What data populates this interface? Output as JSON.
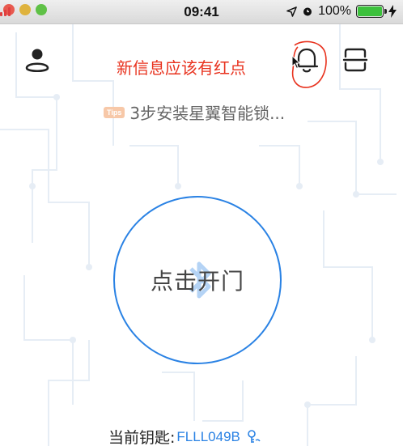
{
  "status_bar": {
    "time": "09:41",
    "battery": "100%"
  },
  "header": {
    "annotation_note": "新信息应该有红点"
  },
  "tip": {
    "badge": "Tips",
    "text": "3步安装星翼智能锁..."
  },
  "unlock": {
    "label": "点击开门"
  },
  "current_key": {
    "prefix": "当前钥匙:",
    "id": "FLLL049B"
  },
  "colors": {
    "accent": "#2a82e4",
    "annotation_red": "#e8321e",
    "battery_green": "#3cc13c"
  }
}
